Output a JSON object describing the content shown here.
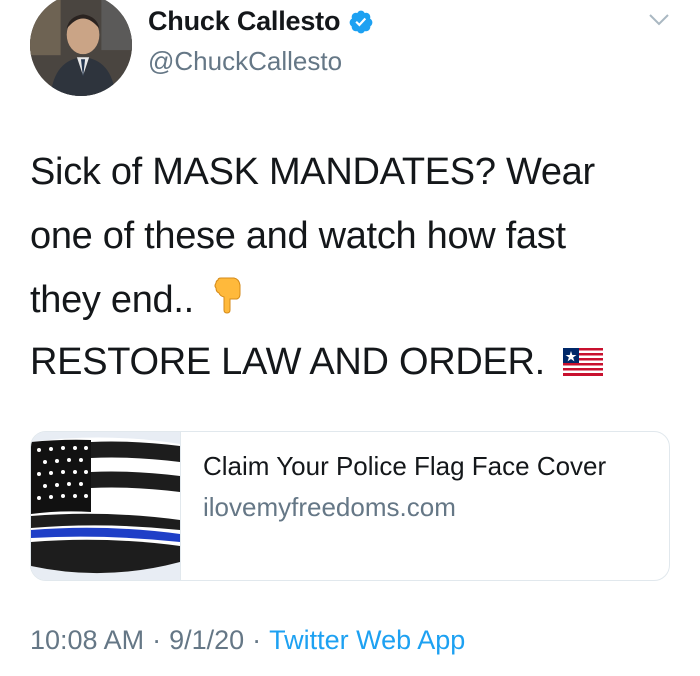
{
  "author": {
    "name": "Chuck Callesto",
    "handle": "@ChuckCallesto",
    "verified": true
  },
  "tweet": {
    "lines": [
      "Sick of MASK MANDATES?  Wear",
      "one of these and watch how fast",
      "they end.."
    ],
    "line2": "RESTORE LAW AND ORDER.",
    "emojis": [
      "backhand-index-pointing-down",
      "liberia-flag"
    ]
  },
  "card": {
    "title": "Claim Your Police Flag Face Cover",
    "domain": "ilovemyfreedoms.com"
  },
  "meta": {
    "time": "10:08 AM",
    "separator": "·",
    "date": "9/1/20",
    "app": "Twitter Web App"
  },
  "colors": {
    "text": "#14171a",
    "secondary": "#657786",
    "link": "#1da1f2",
    "verified": "#1da1f2",
    "border": "#e1e8ed"
  }
}
